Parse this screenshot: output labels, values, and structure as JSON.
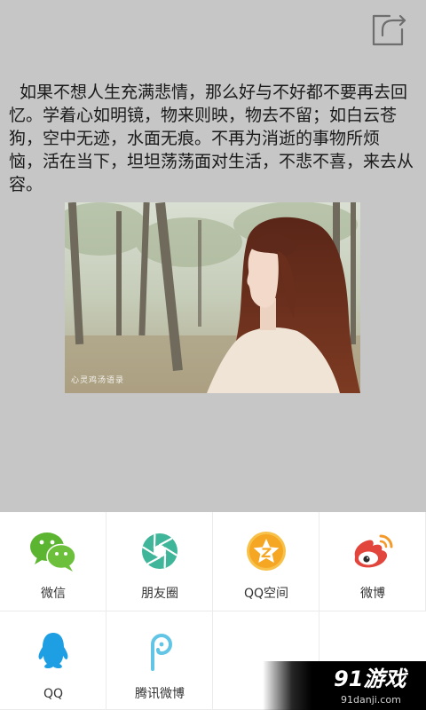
{
  "page": {
    "overlay_color": "#c6c6c6"
  },
  "header": {
    "share_icon": "share-icon",
    "icon_color": "#6e6e6e"
  },
  "article": {
    "lines": [
      "如果不想人生充满悲情，那么好与不好都不要再去回",
      "忆。学着心如明镜，物来则映，物去不留；如白云苍",
      "狗，空中无迹，水面无痕。不再为消逝的事物所烦",
      "恼，活在当下，坦坦荡荡面对生活，不悲不喜，来去从",
      "容。"
    ],
    "photo": {
      "watermark": "心灵鸡汤语录"
    }
  },
  "share_sheet": {
    "items": [
      {
        "label": "微信",
        "icon": "wechat-icon",
        "color": "#5cb531"
      },
      {
        "label": "朋友圈",
        "icon": "moments-aperture-icon",
        "color": "#3fb59a"
      },
      {
        "label": "QQ空间",
        "icon": "qzone-star-icon",
        "color": "#f5a623"
      },
      {
        "label": "微博",
        "icon": "weibo-icon",
        "color": "#e2453c"
      },
      {
        "label": "QQ",
        "icon": "qq-penguin-icon",
        "color": "#1e9fe4"
      },
      {
        "label": "腾讯微博",
        "icon": "tencent-weibo-icon",
        "color": "#62c5e6"
      }
    ]
  },
  "brand_watermark": {
    "logo": "91游戏",
    "url": "91danji.com"
  }
}
